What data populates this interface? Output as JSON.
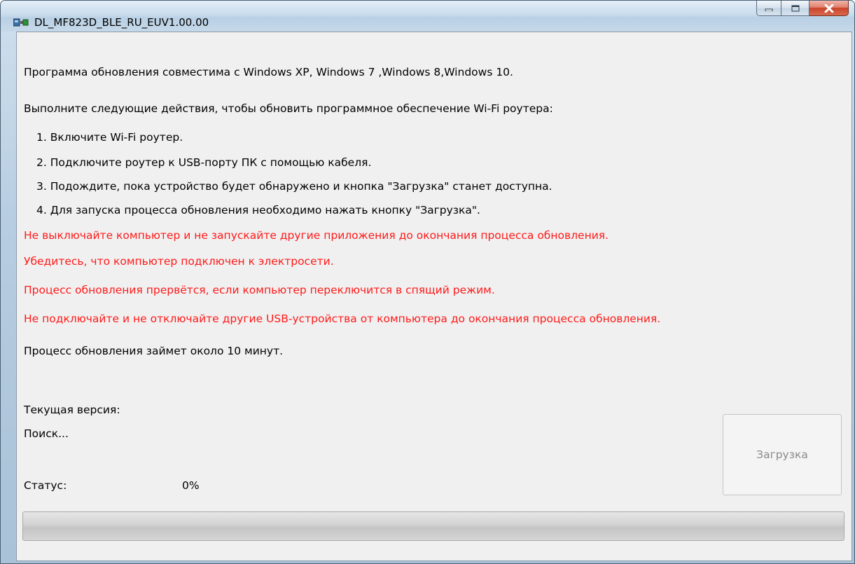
{
  "window": {
    "title": "DL_MF823D_BLE_RU_EUV1.00.00",
    "icons": {
      "app": "device-usb-icon",
      "minimize": "minimize-icon",
      "maximize": "maximize-icon",
      "close": "close-icon"
    }
  },
  "intro": {
    "compatibility": "Программа обновления совместима с Windows XP, Windows 7 ,Windows 8,Windows 10.",
    "instructions_header": "Выполните следующие действия, чтобы обновить программное обеспечение Wi-Fi роутера:",
    "steps": [
      "1. Включите  Wi-Fi роутер.",
      "2. Подключите роутер к USB-порту ПК с помощью кабеля.",
      "3. Подождите, пока устройство будет обнаружено и кнопка \"Загрузка\" станет доступна.",
      "4. Для запуска процесса обновления необходимо нажать кнопку \"Загрузка\"."
    ]
  },
  "warnings": [
    "Не выключайте компьютер и не запускайте другие приложения до окончания процесса обновления.",
    "Убедитесь, что компьютер подключен к электросети.",
    "Процесс обновления прервётся, если компьютер переключится в спящий режим.",
    "Не подключайте и не отключайте другие USB-устройства от компьютера до окончания процесса обновления."
  ],
  "duration_note": "Процесс обновления займет около 10 минут.",
  "version": {
    "label": "Текущая версия:",
    "value": "Поиск..."
  },
  "status": {
    "label": "Статус:",
    "percent_text": "0%"
  },
  "progress": {
    "fraction": 0
  },
  "download_button": {
    "label": "Загрузка",
    "enabled": false
  },
  "colors": {
    "warning_text": "#ff1a1a",
    "disabled_text": "#8a8a8a"
  }
}
